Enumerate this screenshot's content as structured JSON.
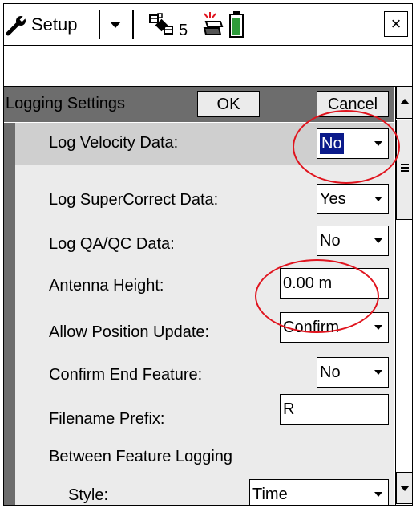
{
  "topbar": {
    "app_title": "Setup",
    "satellite_count": "5",
    "close_label": "×",
    "icons": [
      "wrench-icon",
      "dropdown-arrow-icon",
      "satellite-icon",
      "gnss-receiver-icon",
      "battery-icon"
    ]
  },
  "header": {
    "title": "Logging Settings",
    "ok_label": "OK",
    "cancel_label": "Cancel"
  },
  "settings": [
    {
      "label": "Log Velocity Data:",
      "value": "No",
      "type": "dropdown",
      "selected": true
    },
    {
      "label": "Log SuperCorrect Data:",
      "value": "Yes",
      "type": "dropdown"
    },
    {
      "label": "Log QA/QC Data:",
      "value": "No",
      "type": "dropdown"
    },
    {
      "label": "Antenna Height:",
      "value": "0.00 m",
      "type": "text"
    },
    {
      "label": "Allow Position Update:",
      "value": "Confirm",
      "type": "dropdown"
    },
    {
      "label": "Confirm End Feature:",
      "value": "No",
      "type": "dropdown"
    },
    {
      "label": "Filename Prefix:",
      "value": "R",
      "type": "text"
    },
    {
      "label": "Between Feature Logging",
      "type": "section"
    },
    {
      "label": "Style:",
      "value": "Time",
      "type": "dropdown"
    }
  ],
  "colors": {
    "annotation_ring": "#e0141e",
    "selection": "#0a1a8a",
    "panel": "#ebebeb",
    "header": "#6d6d6d",
    "battery": "#2e9c3a"
  }
}
